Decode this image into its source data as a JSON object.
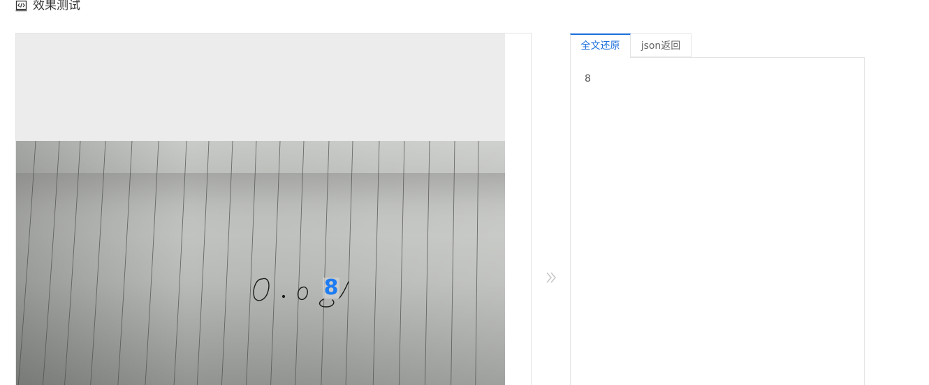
{
  "header": {
    "title": "效果测试",
    "icon": "code-icon"
  },
  "image_panel": {
    "handwritten_text": "0.08",
    "ocr_highlight_text": "8",
    "highlight_color": "#1e7cf2"
  },
  "result": {
    "tabs": [
      {
        "label": "全文还原",
        "active": true
      },
      {
        "label": "json返回",
        "active": false
      }
    ],
    "text": "8",
    "accent_color": "#1d6fdc"
  }
}
